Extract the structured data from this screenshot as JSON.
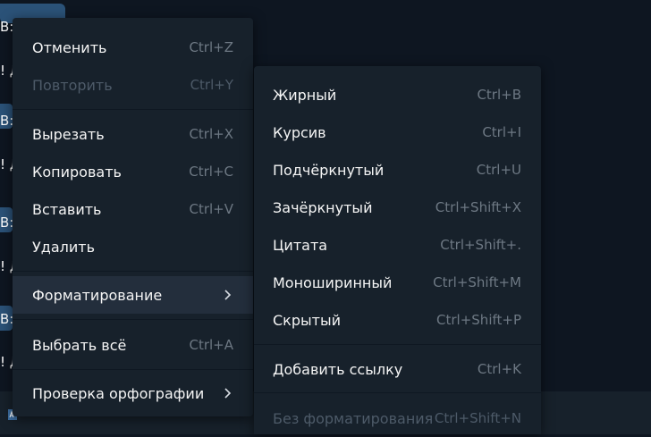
{
  "background": {
    "chat_fragments": [
      "В:",
      "! Д",
      "В:",
      "! Д",
      "В:",
      "! Д",
      "В:",
      "! Д"
    ]
  },
  "context_menu": {
    "items": [
      {
        "label": "Отменить",
        "shortcut": "Ctrl+Z",
        "enabled": true
      },
      {
        "label": "Повторить",
        "shortcut": "Ctrl+Y",
        "enabled": false
      },
      {
        "label": "Вырезать",
        "shortcut": "Ctrl+X",
        "enabled": true
      },
      {
        "label": "Копировать",
        "shortcut": "Ctrl+C",
        "enabled": true
      },
      {
        "label": "Вставить",
        "shortcut": "Ctrl+V",
        "enabled": true
      },
      {
        "label": "Удалить",
        "shortcut": "",
        "enabled": true
      },
      {
        "label": "Форматирование",
        "shortcut": "",
        "enabled": true,
        "submenu": true,
        "highlighted": true
      },
      {
        "label": "Выбрать всё",
        "shortcut": "Ctrl+A",
        "enabled": true
      },
      {
        "label": "Проверка орфографии",
        "shortcut": "",
        "enabled": true,
        "submenu": true
      }
    ]
  },
  "format_submenu": {
    "items": [
      {
        "label": "Жирный",
        "shortcut": "Ctrl+B",
        "enabled": true
      },
      {
        "label": "Курсив",
        "shortcut": "Ctrl+I",
        "enabled": true
      },
      {
        "label": "Подчёркнутый",
        "shortcut": "Ctrl+U",
        "enabled": true
      },
      {
        "label": "Зачёркнутый",
        "shortcut": "Ctrl+Shift+X",
        "enabled": true
      },
      {
        "label": "Цитата",
        "shortcut": "Ctrl+Shift+.",
        "enabled": true
      },
      {
        "label": "Моноширинный",
        "shortcut": "Ctrl+Shift+M",
        "enabled": true
      },
      {
        "label": "Скрытый",
        "shortcut": "Ctrl+Shift+P",
        "enabled": true
      },
      {
        "label": "Добавить ссылку",
        "shortcut": "Ctrl+K",
        "enabled": true
      },
      {
        "label": "Без форматирования",
        "shortcut": "Ctrl+Shift+N",
        "enabled": false
      }
    ]
  },
  "colors": {
    "app_background": "#0e1621",
    "menu_background": "#17212b",
    "highlight": "#232e3c",
    "outgoing_bubble": "#2b5278",
    "text": "#f5f5f5",
    "shortcut_text": "#6d7883",
    "disabled_text": "#4d5a68"
  }
}
